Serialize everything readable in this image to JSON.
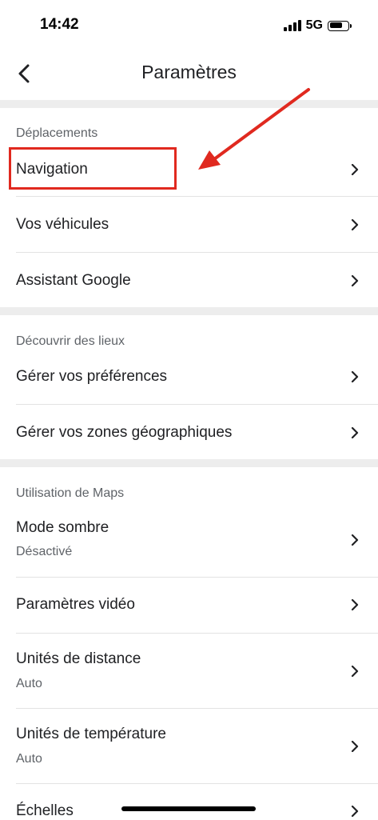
{
  "status_bar": {
    "time": "14:42",
    "network": "5G",
    "battery_level": 0.75,
    "icons": [
      "signal-icon",
      "battery-icon"
    ]
  },
  "header": {
    "back_icon": "chevron-left-icon",
    "title": "Paramètres"
  },
  "sections": [
    {
      "title": "Déplacements",
      "items": [
        {
          "label": "Navigation"
        },
        {
          "label": "Vos véhicules"
        },
        {
          "label": "Assistant Google"
        }
      ]
    },
    {
      "title": "Découvrir des lieux",
      "items": [
        {
          "label": "Gérer vos préférences"
        },
        {
          "label": "Gérer vos zones géographiques"
        }
      ]
    },
    {
      "title": "Utilisation de Maps",
      "items": [
        {
          "label": "Mode sombre",
          "sub": "Désactivé"
        },
        {
          "label": "Paramètres vidéo"
        },
        {
          "label": "Unités de distance",
          "sub": "Auto"
        },
        {
          "label": "Unités de température",
          "sub": "Auto"
        },
        {
          "label": "Échelles"
        }
      ]
    }
  ],
  "annotation": {
    "color": "#e0291f",
    "highlighted_item": "Navigation"
  },
  "colors": {
    "separator": "#ededed",
    "text_primary": "#202124",
    "text_secondary": "#5f6368"
  }
}
